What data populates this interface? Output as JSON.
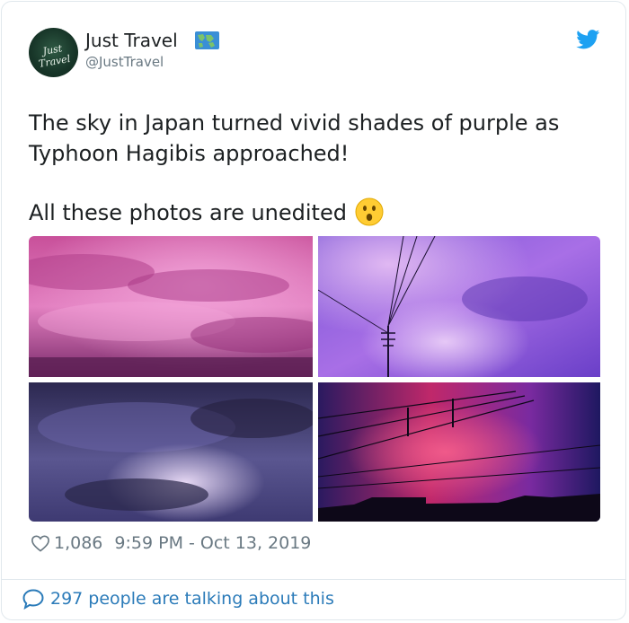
{
  "author": {
    "name": "Just Travel",
    "handle": "@JustTravel",
    "avatar_text": "Just Travel",
    "name_emoji": "world-map-emoji"
  },
  "tweet": {
    "line1": "The sky in Japan turned vivid shades of purple as",
    "line2": "Typhoon Hagibis approached!",
    "line3": "All these photos are unedited",
    "face_emoji": "hushed-face-emoji"
  },
  "photos": [
    {
      "name": "pink-cloud-sky-photo"
    },
    {
      "name": "purple-sky-power-pole-photo"
    },
    {
      "name": "violet-storm-clouds-photo"
    },
    {
      "name": "magenta-sky-power-lines-photo"
    }
  ],
  "footer": {
    "likes": "1,086",
    "timestamp": "9:59 PM - Oct 13, 2019",
    "talking": "297 people are talking about this"
  },
  "colors": {
    "twitter_blue": "#1da1f2",
    "link_blue": "#2b7bb9",
    "muted": "#697882",
    "text": "#1c2022",
    "border": "#e1e8ed"
  }
}
